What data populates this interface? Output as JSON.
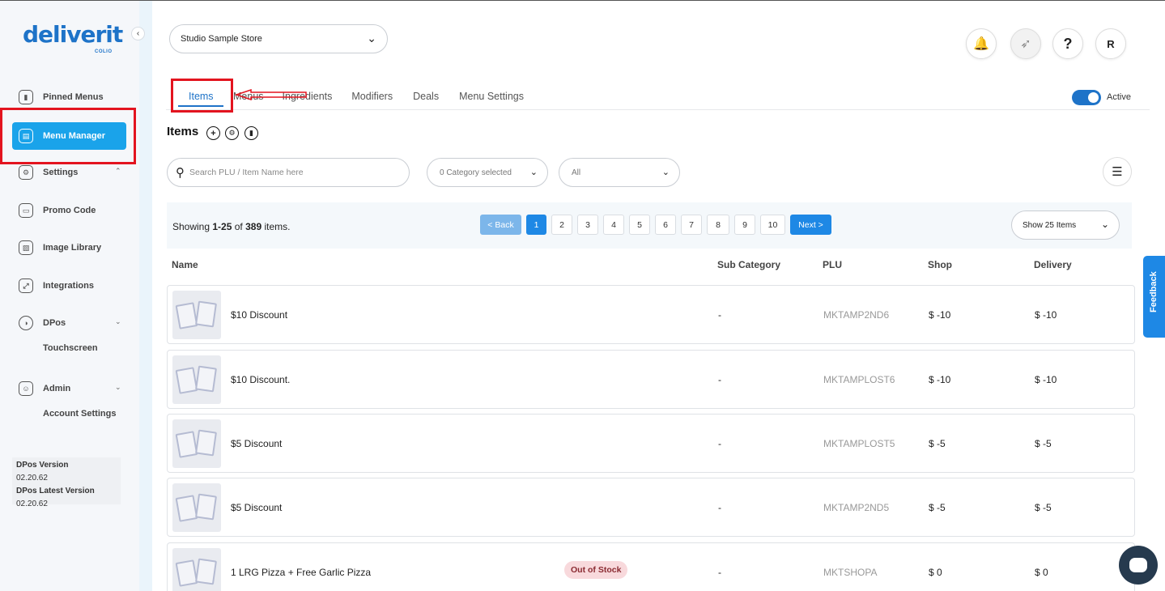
{
  "brand": {
    "logo": "deliverit",
    "logo_sub": "COLIO",
    "accent": "#1e73c8",
    "active_bg": "#1aa3ea",
    "highlight": "#e3141f"
  },
  "sidebar": {
    "items": [
      {
        "label": "Pinned Menus",
        "icon": "bookmark-icon"
      },
      {
        "label": "Menu Manager",
        "icon": "menu-book-icon",
        "active": true
      },
      {
        "label": "Settings",
        "icon": "gear-icon"
      },
      {
        "label": "Promo Code",
        "icon": "ticket-icon"
      },
      {
        "label": "Image Library",
        "icon": "image-icon"
      },
      {
        "label": "Integrations",
        "icon": "plug-icon"
      },
      {
        "label": "DPos",
        "icon": "dpos-icon"
      },
      {
        "label": "Admin",
        "icon": "user-icon"
      }
    ],
    "sub_touchscreen": "Touchscreen",
    "sub_account_settings": "Account Settings",
    "version_label": "DPos Version",
    "version_value": "02.20.62",
    "latest_label": "DPos Latest Version",
    "latest_value": "02.20.62"
  },
  "header": {
    "store": "Studio Sample Store",
    "avatar": "R",
    "help": "?"
  },
  "tabs": [
    "Items",
    "Menus",
    "Ingredients",
    "Modifiers",
    "Deals",
    "Menu Settings"
  ],
  "active_toggle_label": "Active",
  "items_title": "Items",
  "search": {
    "placeholder": "Search PLU / Item Name here"
  },
  "category_filter": "0 Category selected",
  "status_filter": "All",
  "pager": {
    "showing_prefix": "Showing ",
    "range": "1-25",
    "of": " of ",
    "total": "389",
    "suffix": " items.",
    "back": "< Back",
    "next": "Next >",
    "pages": [
      "1",
      "2",
      "3",
      "4",
      "5",
      "6",
      "7",
      "8",
      "9",
      "10"
    ],
    "current": "1",
    "page_size": "Show 25 Items"
  },
  "table": {
    "headers": [
      "Name",
      "Sub Category",
      "PLU",
      "Shop",
      "Delivery"
    ],
    "rows": [
      {
        "name": "$10 Discount",
        "sub": "-",
        "plu": "MKTAMP2ND6",
        "shop": "$ -10",
        "delivery": "$ -10"
      },
      {
        "name": "$10 Discount.",
        "sub": "-",
        "plu": "MKTAMPLOST6",
        "shop": "$ -10",
        "delivery": "$ -10"
      },
      {
        "name": "$5 Discount",
        "sub": "-",
        "plu": "MKTAMPLOST5",
        "shop": "$ -5",
        "delivery": "$ -5"
      },
      {
        "name": "$5 Discount",
        "sub": "-",
        "plu": "MKTAMP2ND5",
        "shop": "$ -5",
        "delivery": "$ -5"
      },
      {
        "name": "1 LRG Pizza + Free Garlic Pizza",
        "badge": "Out of Stock",
        "sub": "-",
        "plu": "MKTSHOPA",
        "shop": "$ 0",
        "delivery": "$ 0"
      }
    ]
  },
  "feedback": "Feedback"
}
